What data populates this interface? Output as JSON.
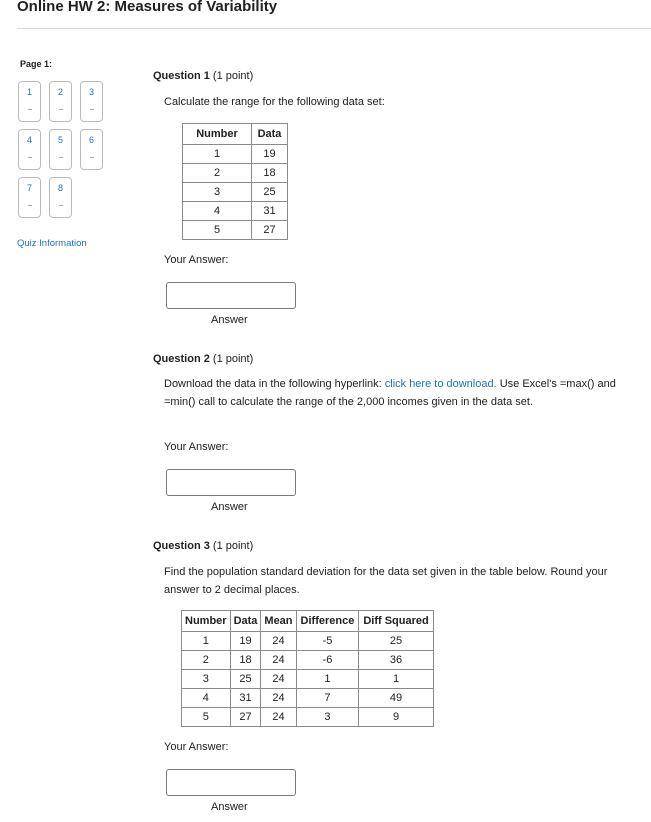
{
  "page": {
    "title": "Online HW 2: Measures of Variability"
  },
  "sidebar": {
    "page_label": "Page 1:",
    "questions": [
      {
        "number": "1",
        "status": "--"
      },
      {
        "number": "2",
        "status": "--"
      },
      {
        "number": "3",
        "status": "--"
      },
      {
        "number": "4",
        "status": "--"
      },
      {
        "number": "5",
        "status": "--"
      },
      {
        "number": "6",
        "status": "--"
      },
      {
        "number": "7",
        "status": "--"
      },
      {
        "number": "8",
        "status": "--"
      }
    ],
    "quiz_info_link": "Quiz Information"
  },
  "questions": [
    {
      "label": "Question 1",
      "points": "(1 point)",
      "text": "Calculate the range for the following data set:",
      "table": {
        "headers": [
          "Number",
          "Data"
        ],
        "rows": [
          [
            "1",
            "19"
          ],
          [
            "2",
            "18"
          ],
          [
            "3",
            "25"
          ],
          [
            "4",
            "31"
          ],
          [
            "5",
            "27"
          ]
        ]
      },
      "your_answer_label": "Your Answer:",
      "answer_value": "",
      "answer_caption": "Answer"
    },
    {
      "label": "Question 2",
      "points": "(1 point)",
      "text_before_link": "Download the data in the following hyperlink: ",
      "link_text": "click here to download.",
      "text_after_link": " Use Excel's =max() and =min() call to calculate the range of the 2,000 incomes given in the data set.",
      "your_answer_label": "Your Answer:",
      "answer_value": "",
      "answer_caption": "Answer"
    },
    {
      "label": "Question 3",
      "points": "(1 point)",
      "text": "Find the population standard deviation for the data set given in the table below. Round your answer to 2 decimal places.",
      "table": {
        "headers": [
          "Number",
          "Data",
          "Mean",
          "Difference",
          "Diff Squared"
        ],
        "rows": [
          [
            "1",
            "19",
            "24",
            "-5",
            "25"
          ],
          [
            "2",
            "18",
            "24",
            "-6",
            "36"
          ],
          [
            "3",
            "25",
            "24",
            "1",
            "1"
          ],
          [
            "4",
            "31",
            "24",
            "7",
            "49"
          ],
          [
            "5",
            "27",
            "24",
            "3",
            "9"
          ]
        ]
      },
      "your_answer_label": "Your Answer:",
      "answer_value": "",
      "answer_caption": "Answer"
    }
  ]
}
